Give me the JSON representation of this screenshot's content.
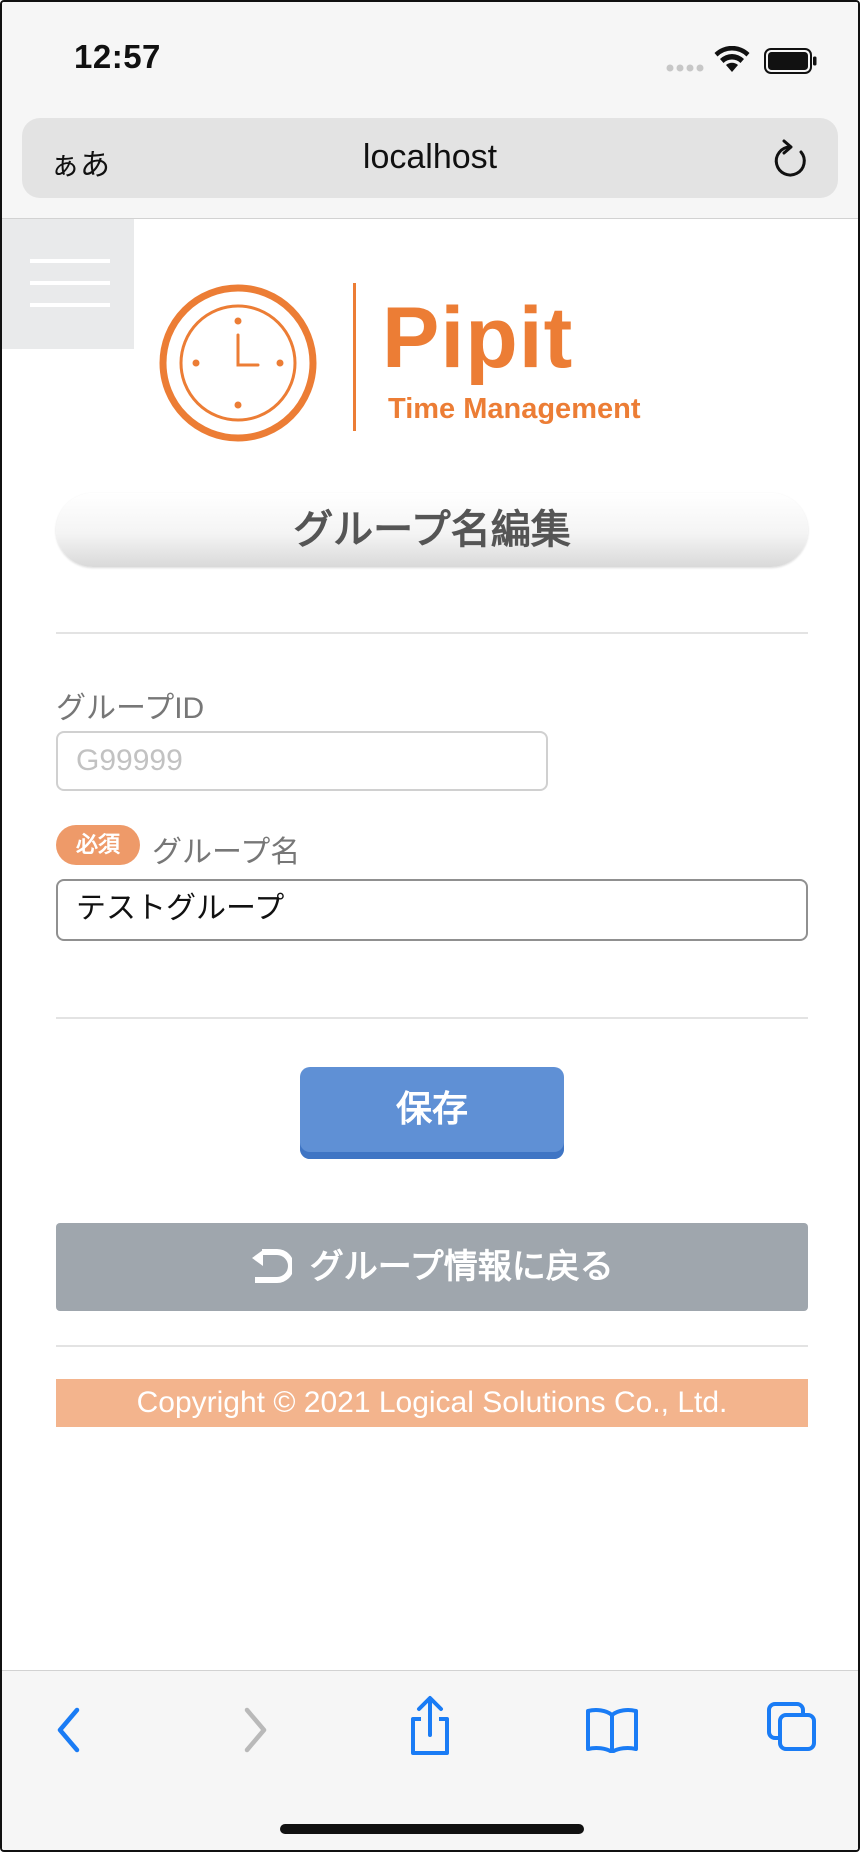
{
  "status_bar": {
    "time": "12:57"
  },
  "browser": {
    "text_size_label": "ぁあ",
    "url": "localhost"
  },
  "logo": {
    "name": "Pipit",
    "tagline": "Time Management"
  },
  "page": {
    "title": "グループ名編集",
    "group_id": {
      "label": "グループID",
      "placeholder": "G99999",
      "value": ""
    },
    "group_name": {
      "required_badge": "必須",
      "label": "グループ名",
      "value": "テストグループ"
    },
    "save_label": "保存",
    "back_label": "グループ情報に戻る",
    "copyright": "Copyright © 2021 Logical Solutions Co., Ltd."
  },
  "colors": {
    "brand": "#ec7d35",
    "save_button": "#5f90d5",
    "back_button": "#9fa6ad",
    "footer": "#f3b48d",
    "ios_blue": "#1a7cf5"
  },
  "icons": {
    "menu": "hamburger-icon",
    "logo": "clock-icon",
    "reload": "reload-icon",
    "back_link": "return-arrow-icon",
    "toolbar": [
      "back-icon",
      "forward-icon",
      "share-icon",
      "bookmarks-icon",
      "tabs-icon"
    ]
  }
}
